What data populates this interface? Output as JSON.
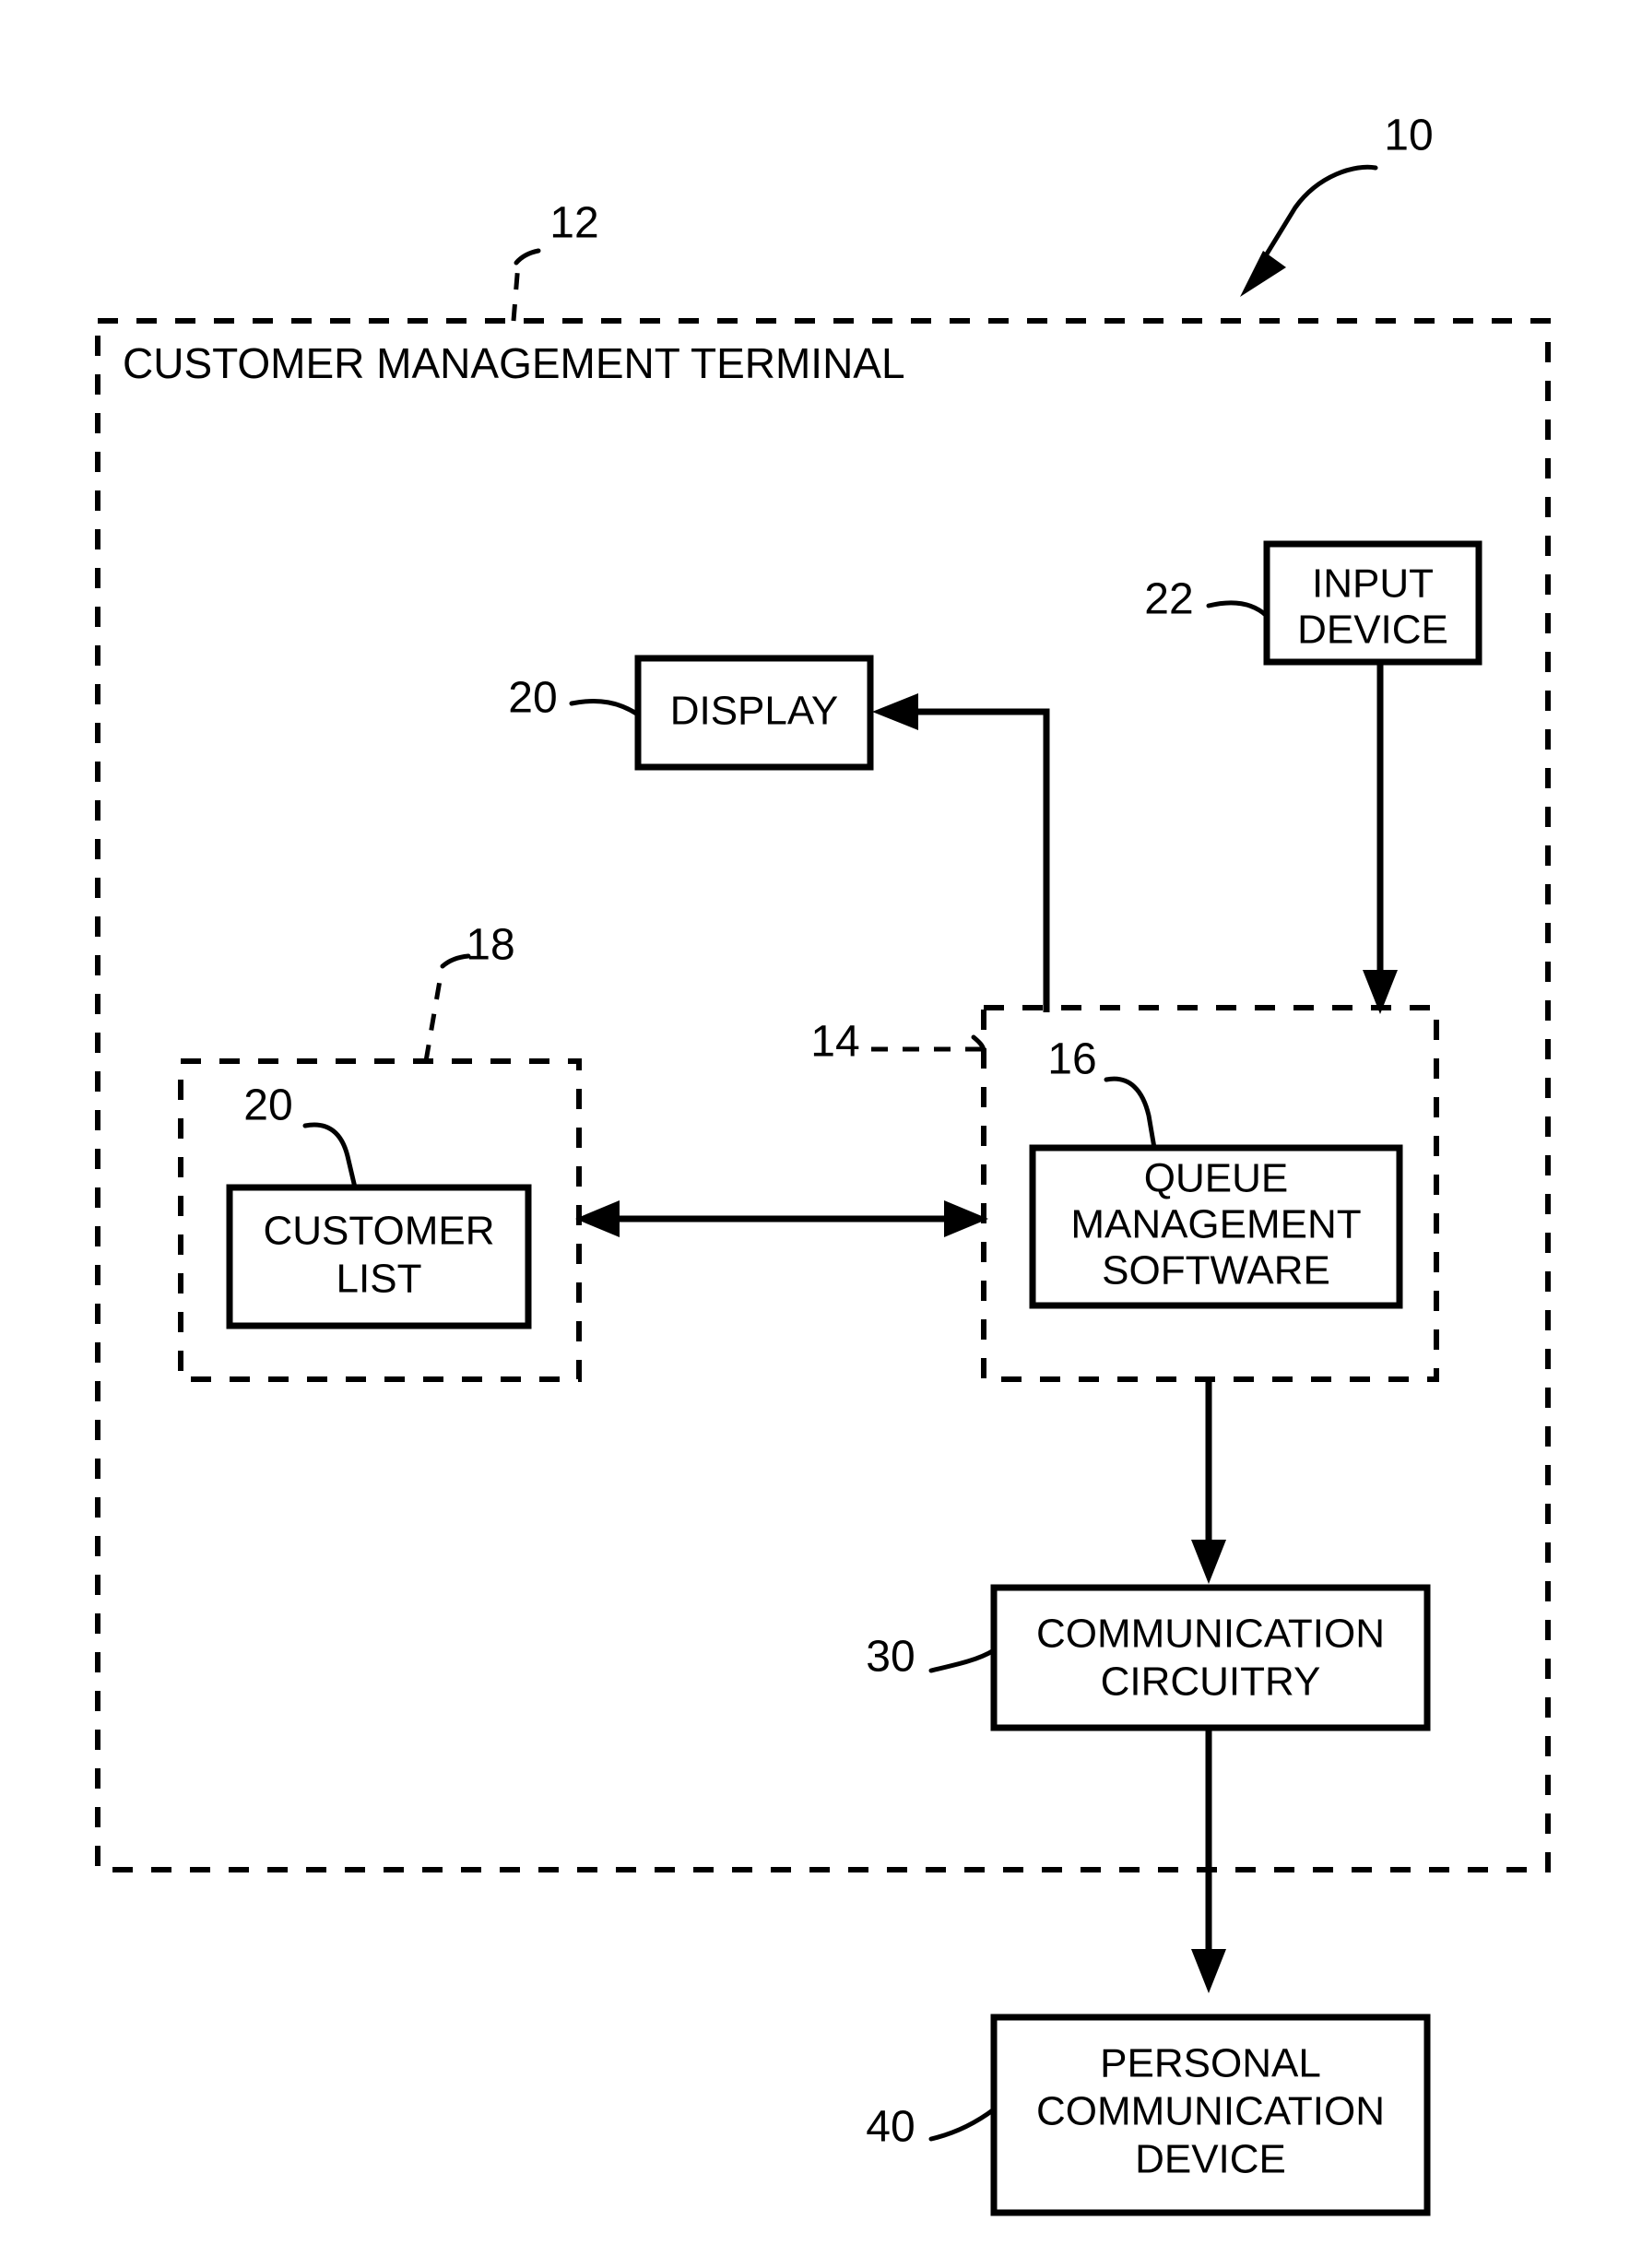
{
  "figure": {
    "reference_numeral": "10",
    "terminal": {
      "title": "CUSTOMER MANAGEMENT TERMINAL",
      "reference_numeral": "12"
    },
    "boxes": {
      "input_device": {
        "line1": "INPUT",
        "line2": "DEVICE",
        "reference_numeral": "22"
      },
      "display": {
        "label": "DISPLAY",
        "reference_numeral": "20"
      },
      "customer_list": {
        "line1": "CUSTOMER",
        "line2": "LIST",
        "reference_numeral": "20"
      },
      "queue_management_software": {
        "line1": "QUEUE",
        "line2": "MANAGEMENT",
        "line3": "SOFTWARE",
        "reference_numeral": "16"
      },
      "communication_circuitry": {
        "line1": "COMMUNICATION",
        "line2": "CIRCUITRY",
        "reference_numeral": "30"
      },
      "personal_communication_device": {
        "line1": "PERSONAL",
        "line2": "COMMUNICATION",
        "line3": "DEVICE",
        "reference_numeral": "40"
      }
    },
    "regions": {
      "customer_list_region": {
        "reference_numeral": "18"
      },
      "queue_region": {
        "reference_numeral": "14"
      }
    },
    "colors": {
      "ink": "#000000",
      "paper": "#ffffff"
    }
  }
}
